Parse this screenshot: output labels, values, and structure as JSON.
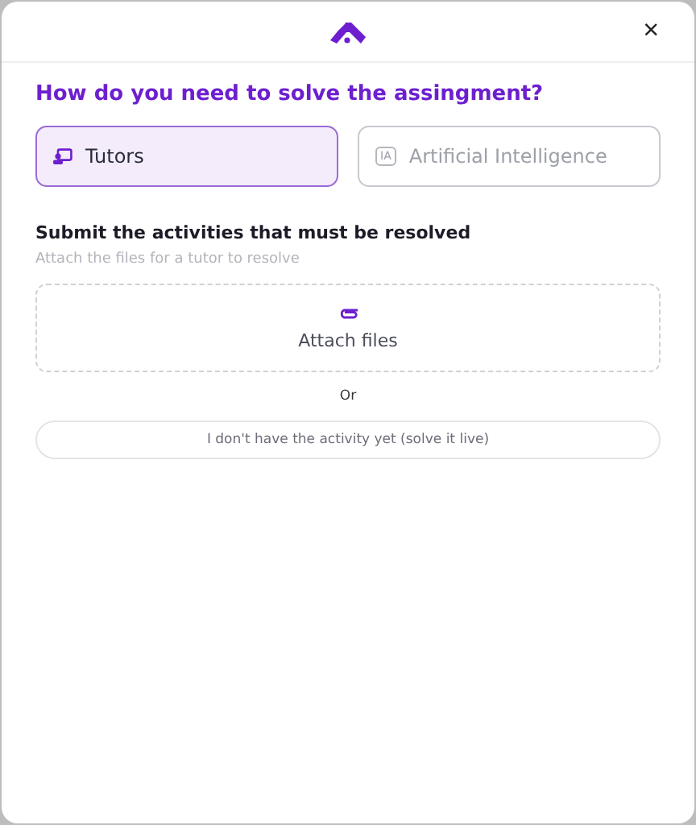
{
  "dialog": {
    "close_icon": "×"
  },
  "question": "How do you need to solve the assingment?",
  "options": [
    {
      "kind": "tutor",
      "label": "Tutors",
      "selected": true
    },
    {
      "kind": "ai",
      "badge": "IA",
      "label": "Artificial Intelligence",
      "selected": false
    }
  ],
  "section": {
    "title": "Submit the activities that must be resolved",
    "subtitle": "Attach the files for a tutor to resolve"
  },
  "dropzone": {
    "label": "Attach files"
  },
  "divider_text": "Or",
  "live_button": "I don't have the activity yet (solve it live)"
}
